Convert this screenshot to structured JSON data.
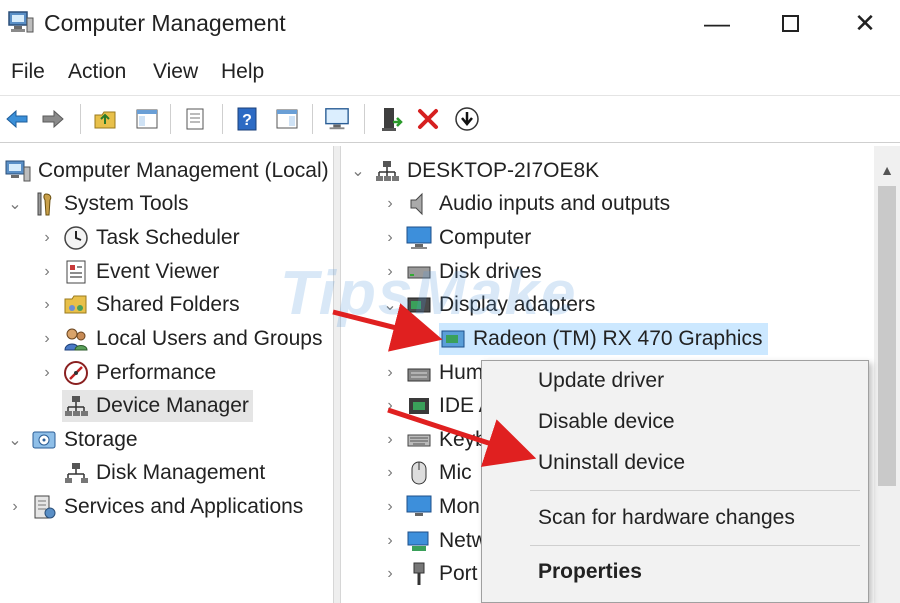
{
  "window": {
    "title": "Computer Management",
    "minimize_glyph": "—",
    "close_glyph": "✕"
  },
  "menu": [
    "File",
    "Action",
    "View",
    "Help"
  ],
  "toolbar": {
    "buttons": [
      "back-icon",
      "forward-icon",
      "up-folder-icon",
      "show-hide-tree-icon",
      "properties-sheet-icon",
      "help-icon",
      "show-action-pane-icon",
      "monitor-icon",
      "update-driver-icon",
      "uninstall-red-x-icon",
      "download-arrow-icon"
    ]
  },
  "left_tree": {
    "root": "Computer Management (Local)",
    "items": [
      {
        "label": "System Tools",
        "icon": "tools-icon"
      },
      {
        "label": "Task Scheduler",
        "icon": "clock-icon"
      },
      {
        "label": "Event Viewer",
        "icon": "event-viewer-icon"
      },
      {
        "label": "Shared Folders",
        "icon": "shared-folder-icon"
      },
      {
        "label": "Local Users and Groups",
        "icon": "users-icon"
      },
      {
        "label": "Performance",
        "icon": "performance-icon"
      },
      {
        "label": "Device Manager",
        "icon": "device-manager-icon"
      },
      {
        "label": "Storage",
        "icon": "storage-icon"
      },
      {
        "label": "Disk Management",
        "icon": "disk-icon"
      },
      {
        "label": "Services and Applications",
        "icon": "services-icon"
      }
    ]
  },
  "device_tree": {
    "computer": "DESKTOP-2I7OE8K",
    "categories": [
      {
        "label": "Audio inputs and outputs",
        "icon": "speaker-icon"
      },
      {
        "label": "Computer",
        "icon": "computer-icon"
      },
      {
        "label": "Disk drives",
        "icon": "disk-drive-icon"
      },
      {
        "label": "Display adapters",
        "icon": "display-adapter-icon"
      },
      {
        "label": "Radeon (TM) RX 470 Graphics",
        "icon": "graphics-card-icon"
      },
      {
        "label": "Hum",
        "icon": "hid-icon"
      },
      {
        "label": "IDE A",
        "icon": "ide-icon"
      },
      {
        "label": "Keyb",
        "icon": "keyboard-icon"
      },
      {
        "label": "Mic",
        "icon": "mouse-icon"
      },
      {
        "label": "Mon",
        "icon": "monitor-icon"
      },
      {
        "label": "Netw",
        "icon": "network-icon"
      },
      {
        "label": "Port",
        "icon": "port-icon"
      }
    ]
  },
  "context_menu": {
    "items": [
      "Update driver",
      "Disable device",
      "Uninstall device",
      "Scan for hardware changes",
      "Properties"
    ]
  },
  "watermark": "TipsMake",
  "colors": {
    "selection": "#cce8ff",
    "arrow_red": "#e02020",
    "menu_bg": "#f2f2f2"
  }
}
